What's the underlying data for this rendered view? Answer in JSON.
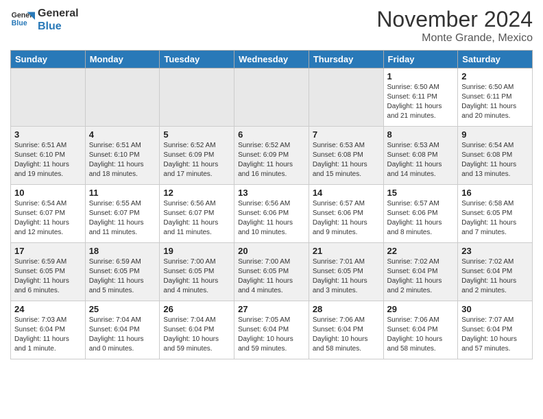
{
  "header": {
    "logo_line1": "General",
    "logo_line2": "Blue",
    "title": "November 2024",
    "subtitle": "Monte Grande, Mexico"
  },
  "days_of_week": [
    "Sunday",
    "Monday",
    "Tuesday",
    "Wednesday",
    "Thursday",
    "Friday",
    "Saturday"
  ],
  "weeks": [
    [
      {
        "day": "",
        "info": "",
        "empty": true
      },
      {
        "day": "",
        "info": "",
        "empty": true
      },
      {
        "day": "",
        "info": "",
        "empty": true
      },
      {
        "day": "",
        "info": "",
        "empty": true
      },
      {
        "day": "",
        "info": "",
        "empty": true
      },
      {
        "day": "1",
        "info": "Sunrise: 6:50 AM\nSunset: 6:11 PM\nDaylight: 11 hours\nand 21 minutes."
      },
      {
        "day": "2",
        "info": "Sunrise: 6:50 AM\nSunset: 6:11 PM\nDaylight: 11 hours\nand 20 minutes."
      }
    ],
    [
      {
        "day": "3",
        "info": "Sunrise: 6:51 AM\nSunset: 6:10 PM\nDaylight: 11 hours\nand 19 minutes."
      },
      {
        "day": "4",
        "info": "Sunrise: 6:51 AM\nSunset: 6:10 PM\nDaylight: 11 hours\nand 18 minutes."
      },
      {
        "day": "5",
        "info": "Sunrise: 6:52 AM\nSunset: 6:09 PM\nDaylight: 11 hours\nand 17 minutes."
      },
      {
        "day": "6",
        "info": "Sunrise: 6:52 AM\nSunset: 6:09 PM\nDaylight: 11 hours\nand 16 minutes."
      },
      {
        "day": "7",
        "info": "Sunrise: 6:53 AM\nSunset: 6:08 PM\nDaylight: 11 hours\nand 15 minutes."
      },
      {
        "day": "8",
        "info": "Sunrise: 6:53 AM\nSunset: 6:08 PM\nDaylight: 11 hours\nand 14 minutes."
      },
      {
        "day": "9",
        "info": "Sunrise: 6:54 AM\nSunset: 6:08 PM\nDaylight: 11 hours\nand 13 minutes."
      }
    ],
    [
      {
        "day": "10",
        "info": "Sunrise: 6:54 AM\nSunset: 6:07 PM\nDaylight: 11 hours\nand 12 minutes."
      },
      {
        "day": "11",
        "info": "Sunrise: 6:55 AM\nSunset: 6:07 PM\nDaylight: 11 hours\nand 11 minutes."
      },
      {
        "day": "12",
        "info": "Sunrise: 6:56 AM\nSunset: 6:07 PM\nDaylight: 11 hours\nand 11 minutes."
      },
      {
        "day": "13",
        "info": "Sunrise: 6:56 AM\nSunset: 6:06 PM\nDaylight: 11 hours\nand 10 minutes."
      },
      {
        "day": "14",
        "info": "Sunrise: 6:57 AM\nSunset: 6:06 PM\nDaylight: 11 hours\nand 9 minutes."
      },
      {
        "day": "15",
        "info": "Sunrise: 6:57 AM\nSunset: 6:06 PM\nDaylight: 11 hours\nand 8 minutes."
      },
      {
        "day": "16",
        "info": "Sunrise: 6:58 AM\nSunset: 6:05 PM\nDaylight: 11 hours\nand 7 minutes."
      }
    ],
    [
      {
        "day": "17",
        "info": "Sunrise: 6:59 AM\nSunset: 6:05 PM\nDaylight: 11 hours\nand 6 minutes."
      },
      {
        "day": "18",
        "info": "Sunrise: 6:59 AM\nSunset: 6:05 PM\nDaylight: 11 hours\nand 5 minutes."
      },
      {
        "day": "19",
        "info": "Sunrise: 7:00 AM\nSunset: 6:05 PM\nDaylight: 11 hours\nand 4 minutes."
      },
      {
        "day": "20",
        "info": "Sunrise: 7:00 AM\nSunset: 6:05 PM\nDaylight: 11 hours\nand 4 minutes."
      },
      {
        "day": "21",
        "info": "Sunrise: 7:01 AM\nSunset: 6:05 PM\nDaylight: 11 hours\nand 3 minutes."
      },
      {
        "day": "22",
        "info": "Sunrise: 7:02 AM\nSunset: 6:04 PM\nDaylight: 11 hours\nand 2 minutes."
      },
      {
        "day": "23",
        "info": "Sunrise: 7:02 AM\nSunset: 6:04 PM\nDaylight: 11 hours\nand 2 minutes."
      }
    ],
    [
      {
        "day": "24",
        "info": "Sunrise: 7:03 AM\nSunset: 6:04 PM\nDaylight: 11 hours\nand 1 minute."
      },
      {
        "day": "25",
        "info": "Sunrise: 7:04 AM\nSunset: 6:04 PM\nDaylight: 11 hours\nand 0 minutes."
      },
      {
        "day": "26",
        "info": "Sunrise: 7:04 AM\nSunset: 6:04 PM\nDaylight: 10 hours\nand 59 minutes."
      },
      {
        "day": "27",
        "info": "Sunrise: 7:05 AM\nSunset: 6:04 PM\nDaylight: 10 hours\nand 59 minutes."
      },
      {
        "day": "28",
        "info": "Sunrise: 7:06 AM\nSunset: 6:04 PM\nDaylight: 10 hours\nand 58 minutes."
      },
      {
        "day": "29",
        "info": "Sunrise: 7:06 AM\nSunset: 6:04 PM\nDaylight: 10 hours\nand 58 minutes."
      },
      {
        "day": "30",
        "info": "Sunrise: 7:07 AM\nSunset: 6:04 PM\nDaylight: 10 hours\nand 57 minutes."
      }
    ]
  ]
}
